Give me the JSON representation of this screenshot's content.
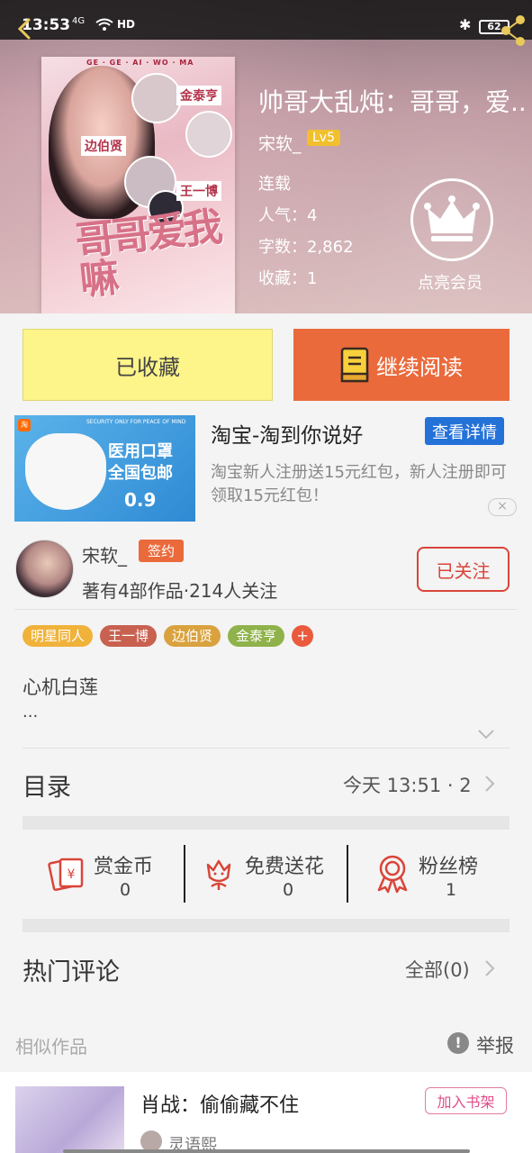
{
  "status": {
    "time": "13:53",
    "signal": "4G",
    "hd": "HD",
    "battery": "62"
  },
  "book": {
    "title": "帅哥大乱炖：哥哥，爱...",
    "author": "宋软_",
    "level": "Lv5",
    "status": "连载",
    "popularity": "人气：4",
    "word_count": "字数：2,862",
    "favorites": "收藏：1",
    "vip_label": "点亮会员",
    "cover": {
      "top_text": "GE · GE · AI · WO · MA",
      "names": [
        "金泰亨",
        "边伯贤",
        "王一博"
      ],
      "big_title": "哥哥爱我嘛"
    }
  },
  "actions": {
    "favorited": "已收藏",
    "continue_reading": "继续阅读"
  },
  "ad": {
    "title": "淘宝-淘到你说好",
    "button": "查看详情",
    "description": "淘宝新人注册送15元红包，新人注册即可领取15元红包！",
    "image_text1": "医用口罩",
    "image_text2": "全国包邮",
    "image_price": "0.9",
    "image_small": "SECURITY ONLY FOR PEACE OF MIND"
  },
  "author": {
    "name": "宋软_",
    "badge": "签约",
    "stats": "著有4部作品·214人关注",
    "follow": "已关注"
  },
  "tags": [
    {
      "label": "明星同人",
      "color": "#f0b23a"
    },
    {
      "label": "王一博",
      "color": "#c8614f"
    },
    {
      "label": "边伯贤",
      "color": "#d9a23e"
    },
    {
      "label": "金泰亨",
      "color": "#8fb24a"
    }
  ],
  "summary": {
    "line1": "心机白莲",
    "line2": "..."
  },
  "catalog": {
    "title": "目录",
    "latest": "今天 13:51 · 2"
  },
  "stats": [
    {
      "label": "赏金币",
      "value": "0",
      "icon": "red-envelope-icon"
    },
    {
      "label": "免费送花",
      "value": "0",
      "icon": "flower-icon"
    },
    {
      "label": "粉丝榜",
      "value": "1",
      "icon": "medal-icon"
    }
  ],
  "comments": {
    "title": "热门评论",
    "all": "全部(0)"
  },
  "similar": {
    "header": "相似作品",
    "report": "举报",
    "items": [
      {
        "title": "肖战：偷偷藏不住",
        "author": "灵语熙",
        "button": "加入书架"
      }
    ]
  },
  "colors": {
    "accent_orange": "#ea6a3c",
    "fav_yellow": "#fdf48a",
    "ad_blue": "#2472d8",
    "follow_red": "#d9453a"
  }
}
